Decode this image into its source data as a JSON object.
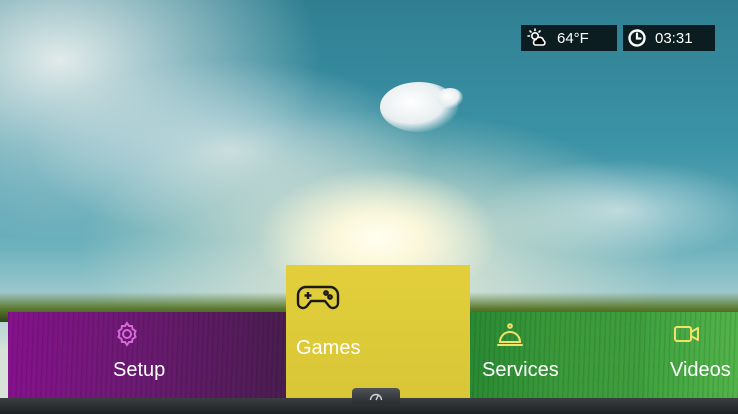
{
  "status": {
    "temperature": "64°F",
    "time": "03:31",
    "weather_icon": "partly-sunny-icon",
    "clock_icon": "clock-icon"
  },
  "menu": {
    "items": [
      {
        "label": "Setup",
        "icon": "gear-icon",
        "color": "#86128d"
      },
      {
        "label": "Games",
        "icon": "gamepad-icon",
        "color": "#e2cf3a",
        "selected": true
      },
      {
        "label": "Services",
        "icon": "service-bell-icon",
        "color": "#3a9a3a"
      },
      {
        "label": "Videos",
        "icon": "video-camera-icon",
        "color": "#52b44a"
      }
    ]
  },
  "bottom": {
    "handle_icon": "dashboard-icon"
  }
}
